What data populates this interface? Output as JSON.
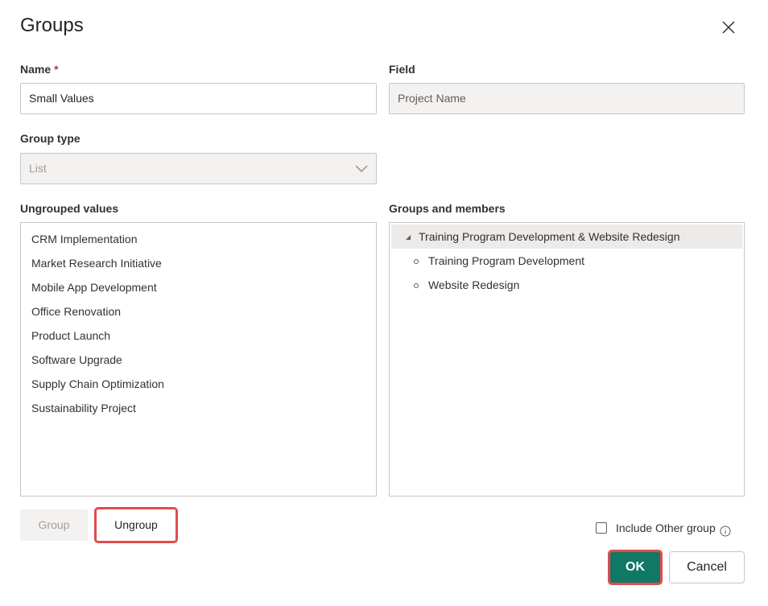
{
  "dialog": {
    "title": "Groups",
    "close_icon": "close-icon"
  },
  "name": {
    "label": "Name",
    "required": "*",
    "value": "Small Values"
  },
  "field": {
    "label": "Field",
    "value": "Project Name"
  },
  "group_type": {
    "label": "Group type",
    "value": "List"
  },
  "ungrouped": {
    "label": "Ungrouped values",
    "items": [
      "CRM Implementation",
      "Market Research Initiative",
      "Mobile App Development",
      "Office Renovation",
      "Product Launch",
      "Software Upgrade",
      "Supply Chain Optimization",
      "Sustainability Project"
    ]
  },
  "groups": {
    "label": "Groups and members",
    "group": "Training Program Development & Website Redesign",
    "members": [
      "Training Program Development",
      "Website Redesign"
    ]
  },
  "buttons": {
    "group": "Group",
    "ungroup": "Ungroup",
    "ok": "OK",
    "cancel": "Cancel"
  },
  "include_other": {
    "label": "Include Other group",
    "checked": false
  },
  "colors": {
    "accent": "#117865",
    "highlight": "#e04c4c"
  }
}
